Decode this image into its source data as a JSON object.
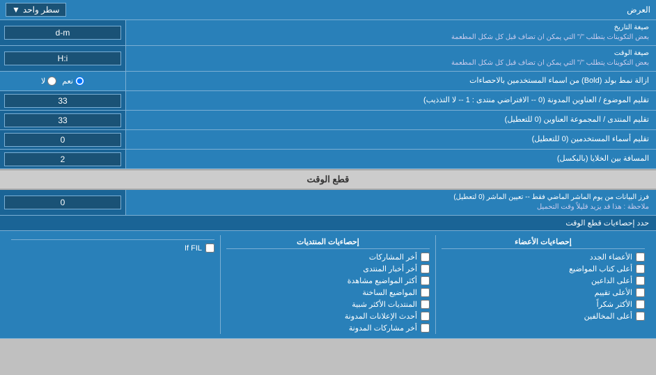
{
  "header": {
    "label_right": "العرض",
    "dropdown_label": "سطر واحد",
    "dropdown_icon": "▼"
  },
  "rows": [
    {
      "id": "date_format",
      "label": "صيغة التاريخ",
      "sublabel": "بعض التكوينات يتطلب \"/\" التي يمكن ان تضاف قبل كل شكل المطعمة",
      "input_value": "d-m",
      "type": "input"
    },
    {
      "id": "time_format",
      "label": "صيغة الوقت",
      "sublabel": "بعض التكوينات يتطلب \"/\" التي يمكن ان تضاف قبل كل شكل المطعمة",
      "input_value": "H:i",
      "type": "input"
    },
    {
      "id": "bold_remove",
      "label": "ازالة نمط بولد (Bold) من اسماء المستخدمين بالاحصاءات",
      "radio_options": [
        {
          "label": "نعم",
          "value": "yes",
          "checked": true
        },
        {
          "label": "لا",
          "value": "no",
          "checked": false
        }
      ],
      "type": "radio"
    },
    {
      "id": "forum_topic",
      "label": "تقليم الموضوع / العناوين المدونة (0 -- الافتراضي منتدى : 1 -- لا التذذيب)",
      "input_value": "33",
      "type": "input"
    },
    {
      "id": "forum_header",
      "label": "تقليم المنتدى / المجموعة العناوين (0 للتعطيل)",
      "input_value": "33",
      "type": "input"
    },
    {
      "id": "username_trim",
      "label": "تقليم أسماء المستخدمين (0 للتعطيل)",
      "input_value": "0",
      "type": "input"
    },
    {
      "id": "cell_spacing",
      "label": "المسافة بين الخلايا (بالبكسل)",
      "input_value": "2",
      "type": "input"
    }
  ],
  "cutoff_section": {
    "title": "قطع الوقت"
  },
  "cutoff_row": {
    "label": "فرز البيانات من يوم الماشر الماضي فقط -- تعيين الماشر (0 لتعطيل)",
    "note": "ملاحظة : هذا قد يزيد قليلاً وقت التحميل",
    "input_value": "0"
  },
  "define_stats": {
    "label": "حدد إحصاءيات قطع الوقت"
  },
  "stats": {
    "col1": {
      "header": "إحصاءيات الأعضاء",
      "items": [
        {
          "label": "الأعضاء الجدد",
          "checked": false
        },
        {
          "label": "أعلى كتاب المواضيع",
          "checked": false
        },
        {
          "label": "أعلى الداعين",
          "checked": false
        },
        {
          "label": "الأعلى تقييم",
          "checked": false
        },
        {
          "label": "الأكثر شكراً",
          "checked": false
        },
        {
          "label": "أعلى المخالفين",
          "checked": false
        }
      ]
    },
    "col2": {
      "header": "إحصاءيات المنتديات",
      "items": [
        {
          "label": "أخر المشاركات",
          "checked": false
        },
        {
          "label": "أخر أخبار المنتدى",
          "checked": false
        },
        {
          "label": "أكثر المواضيع مشاهدة",
          "checked": false
        },
        {
          "label": "المواضيع الساخنة",
          "checked": false
        },
        {
          "label": "المنتديات الأكثر شبية",
          "checked": false
        },
        {
          "label": "أحدث الإعلانات المدونة",
          "checked": false
        },
        {
          "label": "أخر مشاركات المدونة",
          "checked": false
        }
      ]
    },
    "col3": {
      "header": "",
      "items": [
        {
          "label": "If FIL",
          "checked": false
        }
      ]
    }
  }
}
